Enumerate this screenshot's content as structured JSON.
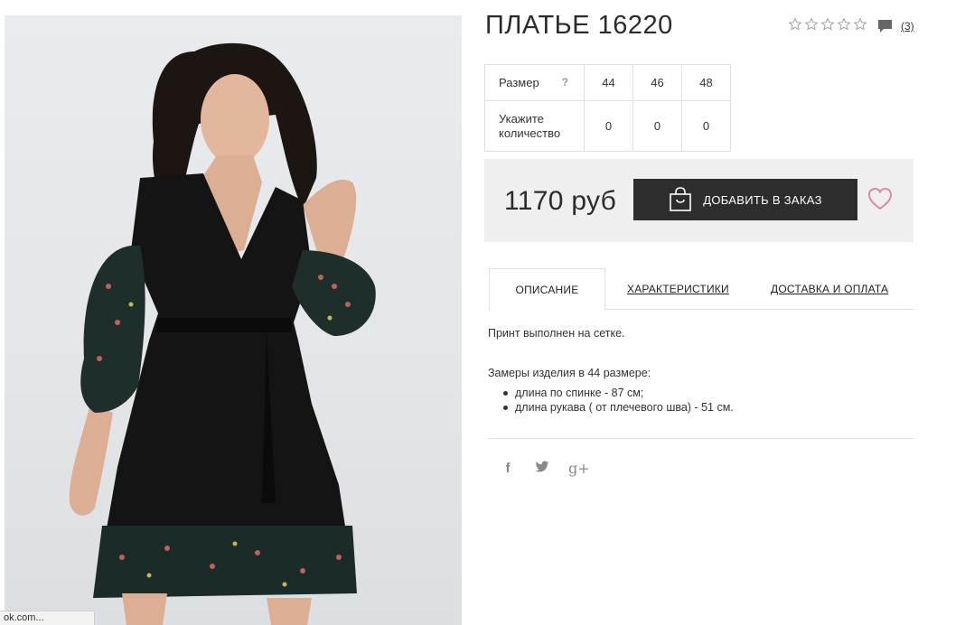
{
  "product": {
    "title": "ПЛАТЬЕ 16220",
    "rating": 0,
    "rating_max": 5,
    "review_count": "(3)"
  },
  "size_table": {
    "size_label": "Размер",
    "help": "?",
    "sizes": [
      "44",
      "46",
      "48"
    ],
    "qty_label_line1": "Укажите",
    "qty_label_line2": "количество",
    "quantities": [
      "0",
      "0",
      "0"
    ]
  },
  "price_panel": {
    "price": "1170 руб",
    "add_button": "ДОБАВИТЬ В ЗАКАЗ"
  },
  "tabs": [
    {
      "label": "ОПИСАНИЕ",
      "active": true
    },
    {
      "label": "ХАРАКТЕРИСТИКИ",
      "active": false
    },
    {
      "label": "ДОСТАВКА И ОПЛАТА",
      "active": false
    }
  ],
  "description": {
    "text": "Принт выполнен на сетке.",
    "measure_title": "Замеры изделия в 44 размере:",
    "items": [
      "длина по спинке - 87 см;",
      "длина рукава ( от плечевого шва) - 51 см."
    ]
  },
  "social": {
    "facebook": "f",
    "twitter": "t",
    "google_plus": "g+"
  },
  "status_bar": {
    "text": "ok.com..."
  },
  "colors": {
    "accent_heart": "#d98aa6",
    "button_bg": "#2d2d2d",
    "panel_bg": "#efefef"
  }
}
